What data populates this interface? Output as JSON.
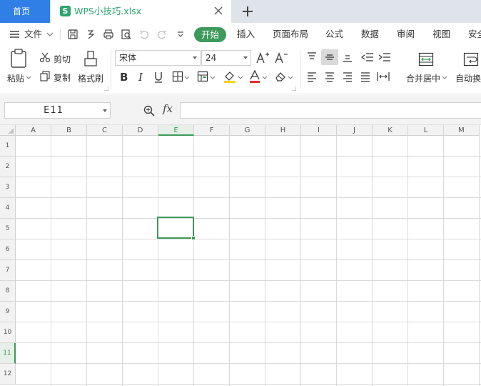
{
  "tabs": {
    "home_label": "首页",
    "file_name": "WPS小技巧.xlsx",
    "file_icon_letter": "S"
  },
  "menu": {
    "file_label": "文件",
    "items": [
      "开始",
      "插入",
      "页面布局",
      "公式",
      "数据",
      "审阅",
      "视图",
      "安全"
    ],
    "active_index": 0
  },
  "ribbon": {
    "paste_label": "粘贴",
    "cut_label": "剪切",
    "copy_label": "复制",
    "format_painter_label": "格式刷",
    "font_name": "宋体",
    "font_size": "24",
    "merge_label": "合并居中",
    "wrap_label": "自动换"
  },
  "formula_bar": {
    "name_box": "E11",
    "fx_label": "fx",
    "formula": ""
  },
  "grid": {
    "columns": [
      "A",
      "B",
      "C",
      "D",
      "E",
      "F",
      "G",
      "H",
      "I",
      "J",
      "K",
      "L",
      "M"
    ],
    "rows": [
      "1",
      "2",
      "3",
      "4",
      "5",
      "6",
      "7",
      "8",
      "9",
      "10",
      "11",
      "12"
    ],
    "active_column": "E",
    "active_row": "11"
  },
  "colors": {
    "accent_green": "#3d9a5a",
    "home_tab_blue": "#2f7fe6",
    "file_green": "#2da56d"
  }
}
